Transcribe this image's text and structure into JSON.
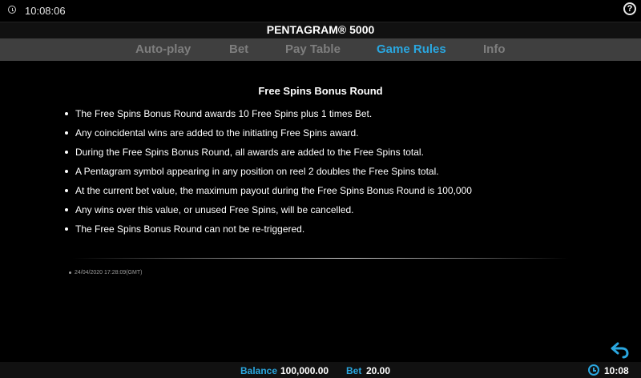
{
  "top_bar": {
    "time": "10:08:06",
    "help_label": "?"
  },
  "header": {
    "game_title": "PENTAGRAM® 5000"
  },
  "tabs": [
    {
      "label": "Auto-play",
      "active": false
    },
    {
      "label": "Bet",
      "active": false
    },
    {
      "label": "Pay Table",
      "active": false
    },
    {
      "label": "Game Rules",
      "active": true
    },
    {
      "label": "Info",
      "active": false
    }
  ],
  "content": {
    "section_title": "Free Spins Bonus Round",
    "rules": [
      "The Free Spins Bonus Round awards 10 Free Spins plus 1 times Bet.",
      "Any coincidental wins are added to the initiating Free Spins award.",
      "During the Free Spins Bonus Round, all awards are added to the Free Spins total.",
      "A Pentagram symbol appearing in any position on reel 2 doubles the Free Spins total.",
      "At the current bet value, the maximum payout during the Free Spins Bonus Round is 100,000",
      "Any wins over this value, or unused Free Spins, will be cancelled.",
      "The Free Spins Bonus Round can not be re-triggered."
    ],
    "timestamp": "24/04/2020 17:28:09(GMT)"
  },
  "bottom_bar": {
    "balance_label": "Balance",
    "balance_value": "100,000.00",
    "bet_label": "Bet",
    "bet_value": "20.00",
    "time": "10:08"
  },
  "colors": {
    "accent": "#2aa7e0",
    "tab_inactive": "#7e7e7e",
    "tab_bar_bg": "#3f3f3f",
    "background": "#000000"
  },
  "icons": {
    "top_left": "clock-icon",
    "top_right": "help-icon",
    "back": "back-arrow-icon",
    "bottom_clock": "clock-icon"
  }
}
